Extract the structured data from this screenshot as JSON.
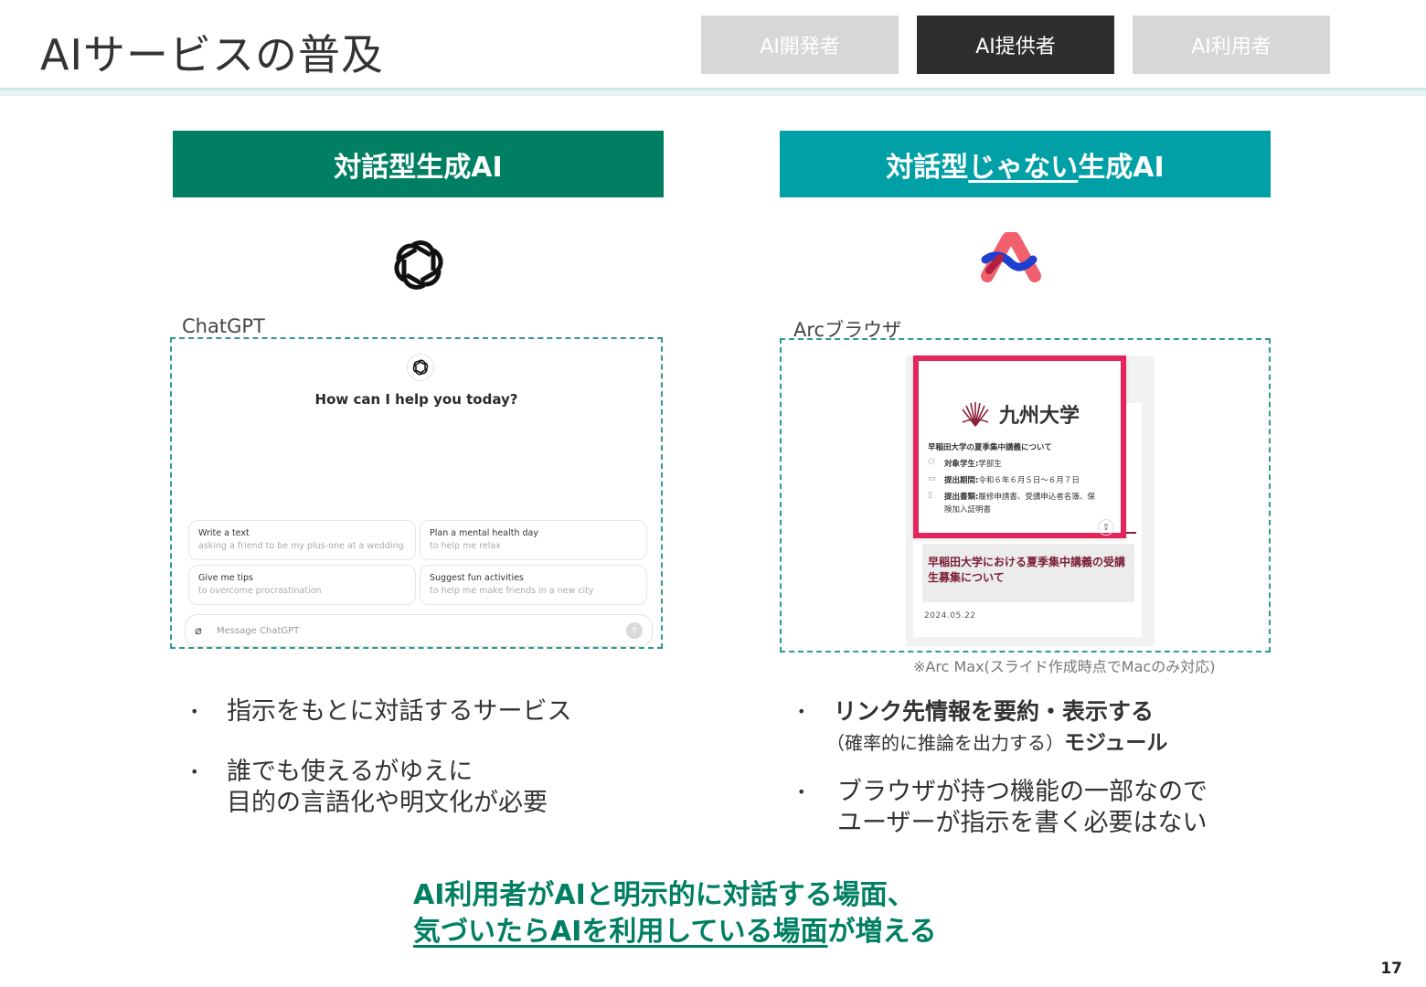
{
  "slide": {
    "title": "AIサービスの普及",
    "page_number": "17"
  },
  "tabs": [
    {
      "label": "AI開発者",
      "active": false
    },
    {
      "label": "AI提供者",
      "active": true
    },
    {
      "label": "AI利用者",
      "active": false
    }
  ],
  "left_column": {
    "header": "対話型生成AI",
    "logo_icon": "openai-logo-icon",
    "caption": "ChatGPT",
    "screenshot": {
      "heading": "How can I help you today?",
      "suggestions": [
        {
          "title": "Write a text",
          "subtitle": "asking a friend to be my plus-one at a wedding"
        },
        {
          "title": "Plan a mental health day",
          "subtitle": "to help me relax"
        },
        {
          "title": "Give me tips",
          "subtitle": "to overcome procrastination"
        },
        {
          "title": "Suggest fun activities",
          "subtitle": "to help me make friends in a new city"
        }
      ],
      "input_placeholder": "Message ChatGPT"
    },
    "bullets": [
      "指示をもとに対話するサービス",
      "誰でも使えるがゆえに",
      "目的の言語化や明文化が必要"
    ]
  },
  "right_column": {
    "header_prefix": "対話型",
    "header_underlined": "じゃない",
    "header_suffix": "生成AI",
    "logo_icon": "arc-logo-icon",
    "caption": "Arcブラウザ",
    "screenshot": {
      "university": "九州大学",
      "popup_title": "早稲田大学の夏季集中講義について",
      "rows": [
        {
          "label": "対象学生:",
          "value": "学部生"
        },
        {
          "label": "提出期間:",
          "value": "令和６年６月５日〜６月７日"
        },
        {
          "label": "提出書類:",
          "value": "履修申請書、受講申込者名簿、保"
        }
      ],
      "row3_continued": "険加入証明書",
      "news_title": "早稲田大学における夏季集中講義の受講生募集について",
      "news_date": "2024.05.22"
    },
    "note": "※Arc Max(スライド作成時点でMacのみ対応)",
    "bullets": {
      "first_main": "リンク先情報を要約・表示する",
      "first_sub_paren": "（確率的に推論を出力する）",
      "first_sub_bold": "モジュール",
      "second_line1": "ブラウザが持つ機能の一部なので",
      "second_line2": "ユーザーが指示を書く必要はない"
    }
  },
  "conclusion": {
    "line1": "AI利用者がAIと明示的に対話する場面、",
    "line2_underlined": "気づいたらAIを利用している場面",
    "line2_suffix": "が増える"
  },
  "colors": {
    "left_header": "#007f62",
    "right_header": "#00a0a6",
    "active_tab": "#2e2e2e",
    "inactive_tab": "#d7d7d7",
    "conclusion_text": "#007f62",
    "popup_border": "#e4245c"
  }
}
